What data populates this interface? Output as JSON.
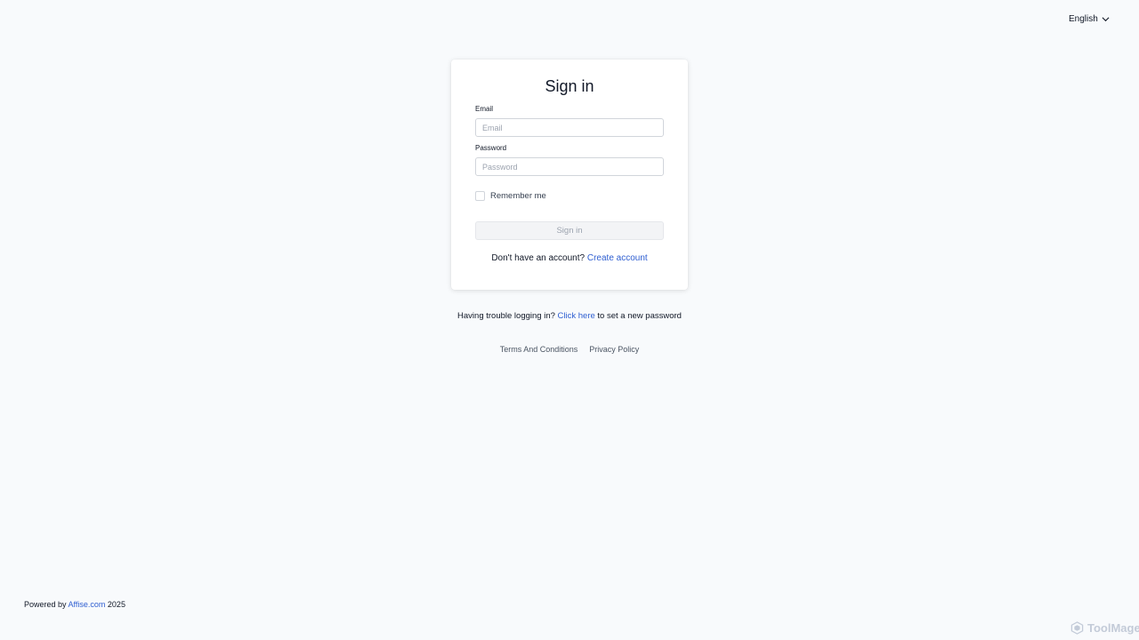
{
  "header": {
    "language": "English"
  },
  "login": {
    "title": "Sign in",
    "email_label": "Email",
    "email_placeholder": "Email",
    "email_value": "",
    "password_label": "Password",
    "password_placeholder": "Password",
    "password_value": "",
    "remember_label": "Remember me",
    "remember_checked": false,
    "submit_label": "Sign in",
    "no_account_text": "Don't have an account?",
    "create_account_link": "Create account"
  },
  "help": {
    "prefix": "Having trouble logging in?",
    "link": "Click here",
    "suffix": "to set a new password"
  },
  "legal": {
    "terms": "Terms And Conditions",
    "privacy": "Privacy Policy"
  },
  "footer": {
    "powered_prefix": "Powered by",
    "powered_link": "Affise.com",
    "year": "2025"
  },
  "watermark": {
    "text": "ToolMage"
  },
  "colors": {
    "background": "#f8fafc",
    "link": "#2f5fd1",
    "disabled_button": "#f3f4f6"
  }
}
